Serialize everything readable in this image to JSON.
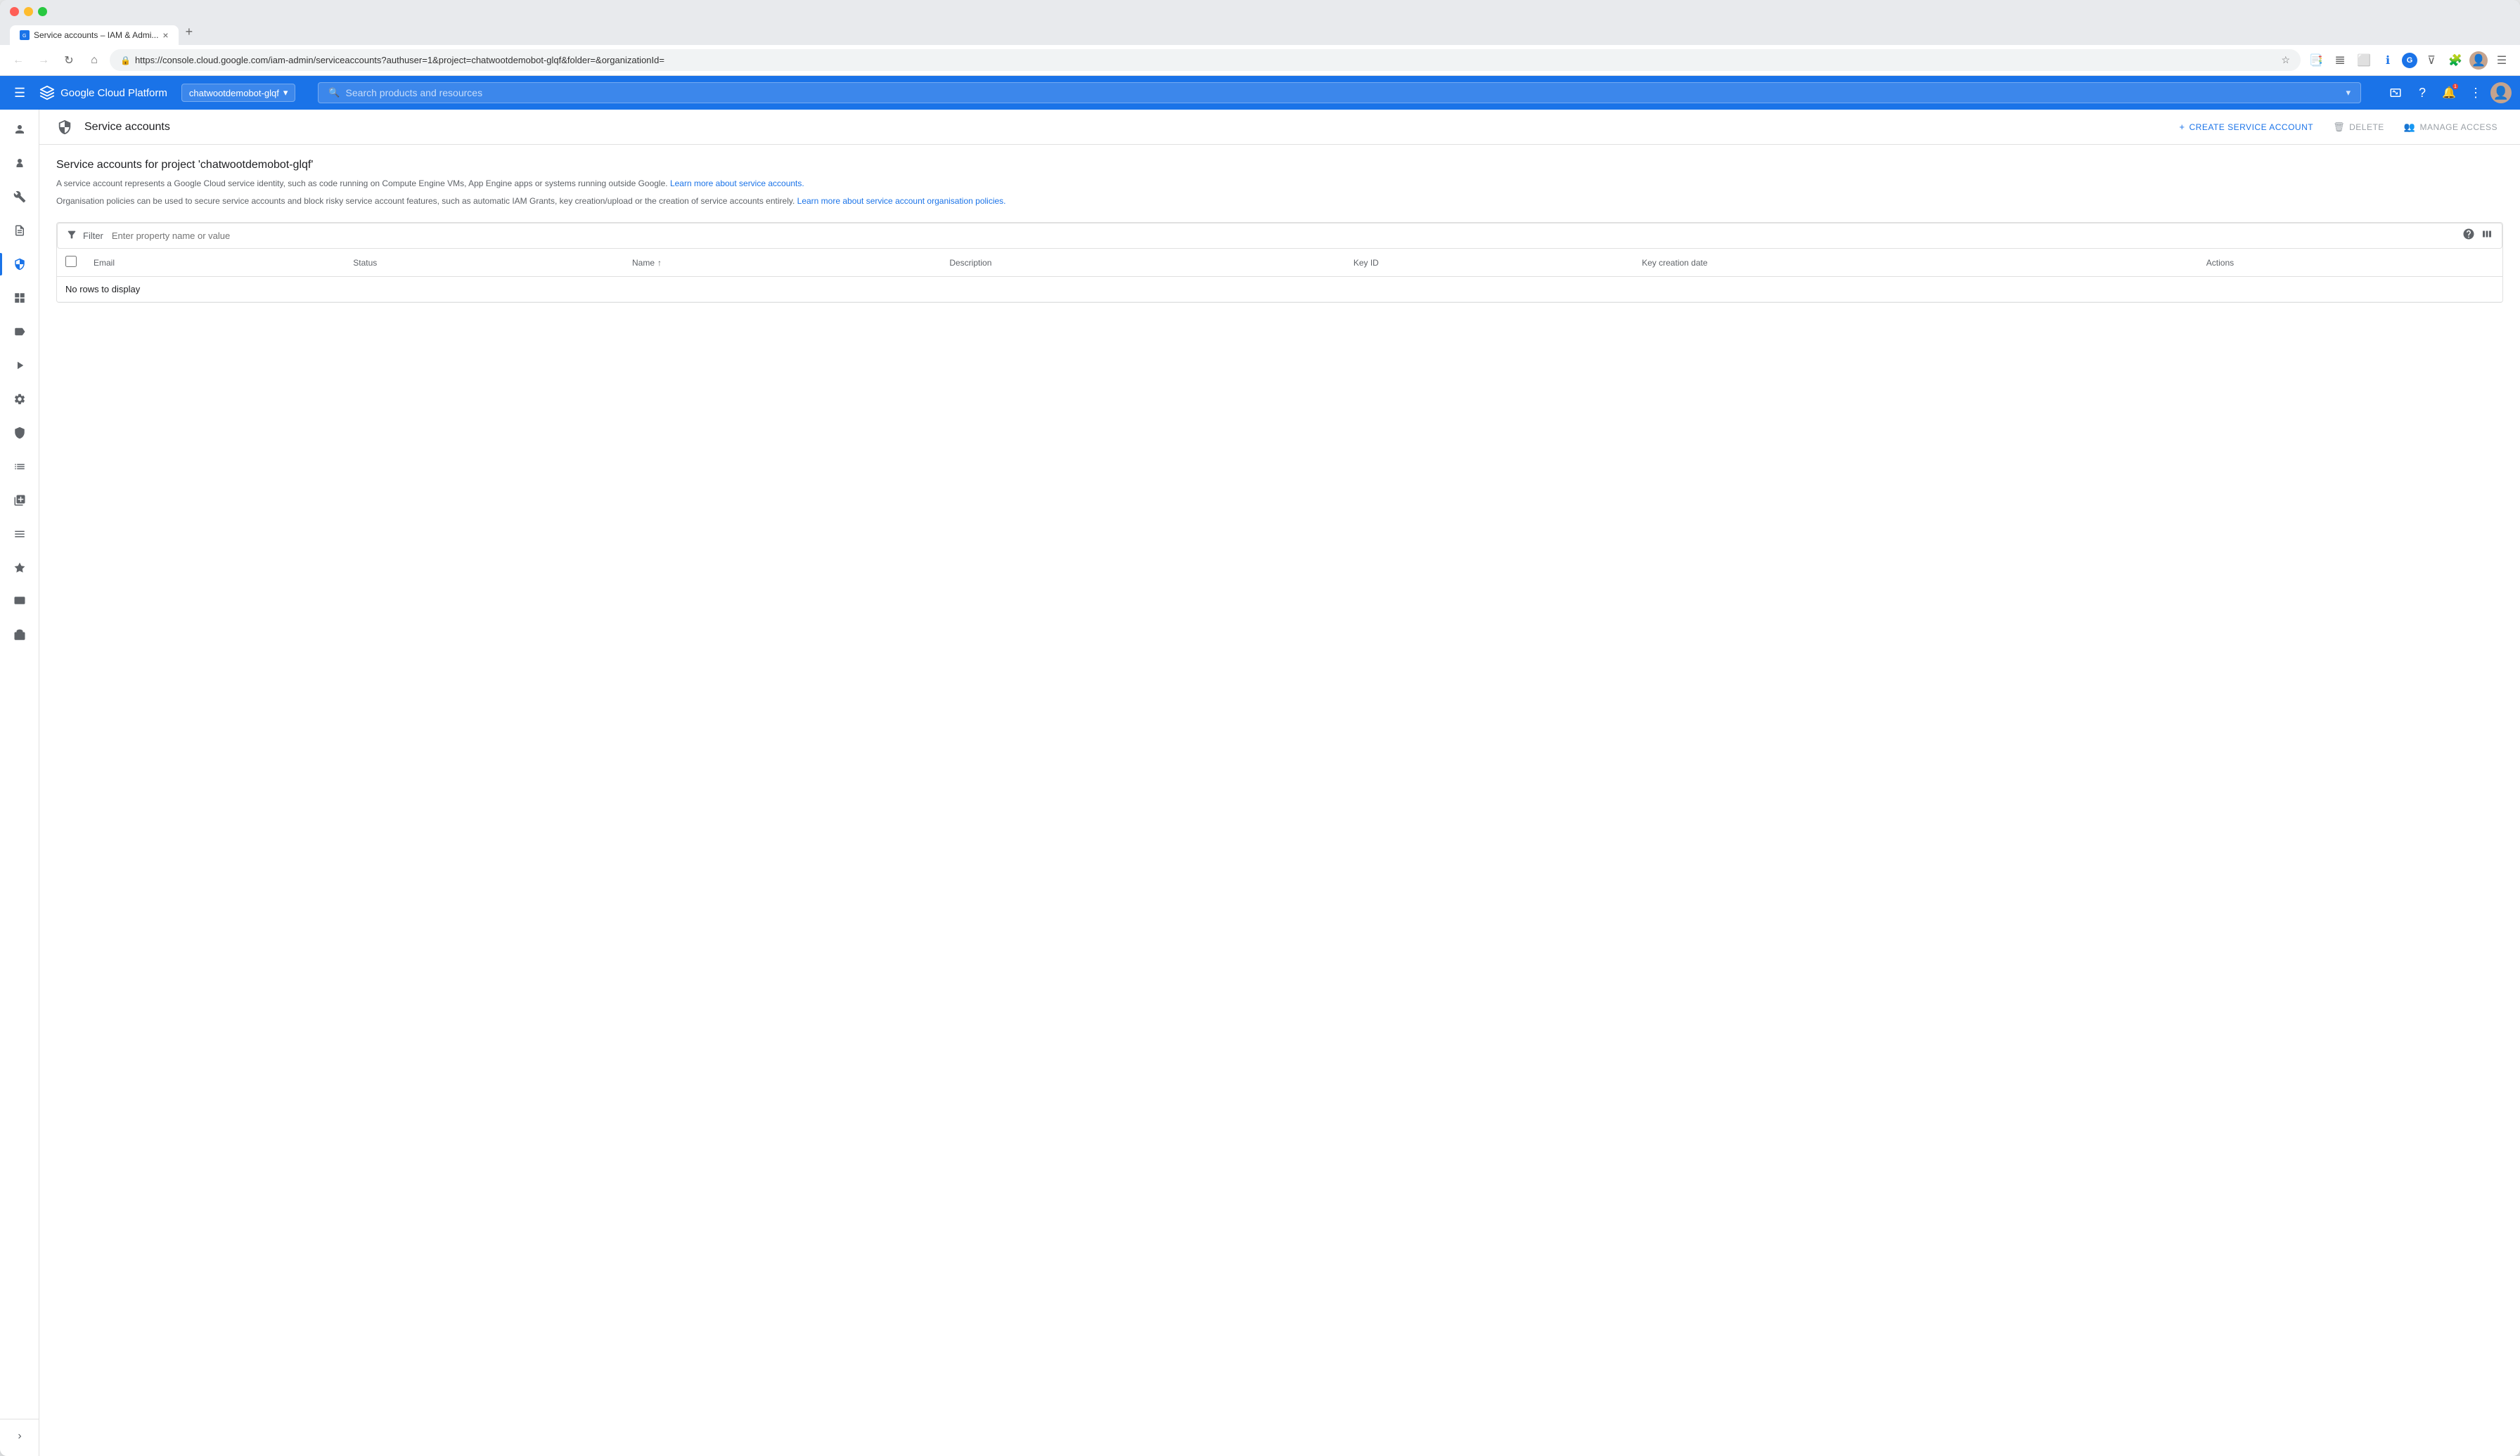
{
  "browser": {
    "tab_label": "Service accounts – IAM & Admi...",
    "tab_close": "×",
    "new_tab": "+",
    "url": "https://console.cloud.google.com/iam-admin/serviceaccounts?authuser=1&project=chatwootdemobot-glqf&folder=&organizationId=",
    "nav_back": "←",
    "nav_forward": "→",
    "nav_refresh": "↻",
    "nav_home": "⌂"
  },
  "topnav": {
    "hamburger": "☰",
    "app_name": "Google Cloud Platform",
    "project_name": "chatwootdemobot-glqf",
    "project_arrow": "▾",
    "search_placeholder": "Search products and resources",
    "search_arrow": "▾"
  },
  "page_header": {
    "icon": "🛡",
    "title": "Service accounts",
    "create_btn": "+ CREATE SERVICE ACCOUNT",
    "delete_btn": "🗑 DELETE",
    "manage_btn": "👥 MANAGE ACCESS"
  },
  "content": {
    "section_title": "Service accounts for project 'chatwootdemobot-glqf'",
    "desc1": "A service account represents a Google Cloud service identity, such as code running on Compute Engine VMs, App Engine apps or systems running outside Google.",
    "desc1_link": "Learn more about service accounts.",
    "desc2": "Organisation policies can be used to secure service accounts and block risky service account features, such as automatic IAM Grants, key creation/upload or the creation of service accounts entirely.",
    "desc2_link": "Learn more about service account organisation policies.",
    "filter_label": "Filter",
    "filter_placeholder": "Enter property name or value",
    "table": {
      "columns": [
        "Email",
        "Status",
        "Name",
        "Description",
        "Key ID",
        "Key creation date",
        "Actions"
      ],
      "no_rows": "No rows to display"
    }
  },
  "sidebar": {
    "items": [
      {
        "icon": "👤",
        "name": "iam",
        "active": false
      },
      {
        "icon": "🔐",
        "name": "identity",
        "active": false
      },
      {
        "icon": "🔧",
        "name": "tools",
        "active": false
      },
      {
        "icon": "📄",
        "name": "audit",
        "active": false
      },
      {
        "icon": "📋",
        "name": "service-accounts",
        "active": true
      },
      {
        "icon": "⬛",
        "name": "workload",
        "active": false
      },
      {
        "icon": "🏷",
        "name": "labels",
        "active": false
      },
      {
        "icon": "▶",
        "name": "pipeline",
        "active": false
      },
      {
        "icon": "⚙",
        "name": "settings",
        "active": false
      },
      {
        "icon": "🔒",
        "name": "org-policies",
        "active": false
      },
      {
        "icon": "📊",
        "name": "quotas",
        "active": false
      },
      {
        "icon": "📦",
        "name": "assets",
        "active": false
      },
      {
        "icon": "≡",
        "name": "service-config",
        "active": false
      },
      {
        "icon": "◆",
        "name": "certificate",
        "active": false
      },
      {
        "icon": "🖥",
        "name": "consent",
        "active": false
      },
      {
        "icon": "📁",
        "name": "resource-manager",
        "active": false
      }
    ]
  },
  "icons": {
    "search": "🔍",
    "shield": "🛡",
    "filter": "≡",
    "help": "?",
    "columns": "|||",
    "sort_asc": "↑",
    "notifications": "📧",
    "help_circle": "?",
    "info": "ℹ",
    "account": "👤",
    "more_vert": "⋮"
  }
}
